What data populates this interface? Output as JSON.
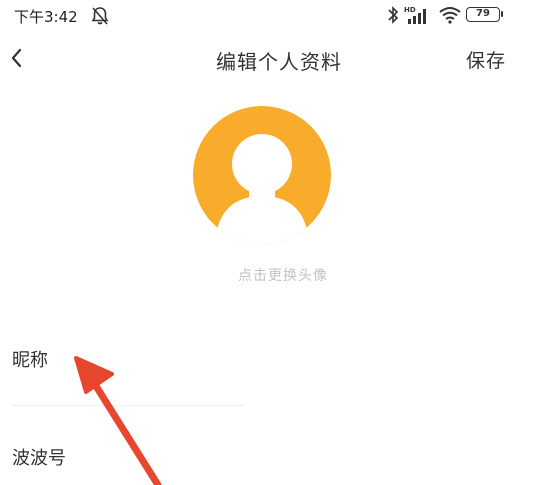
{
  "status_bar": {
    "time": "下午3:42",
    "network_label": "HD",
    "battery": "79"
  },
  "header": {
    "title": "编辑个人资料",
    "save_label": "保存"
  },
  "avatar": {
    "hint": "点击更换头像"
  },
  "form": {
    "nickname_label": "昵称",
    "boboid_label": "波波号"
  },
  "colors": {
    "avatar_bg": "#f9ac2c",
    "arrow": "#e8472f",
    "hint_text": "#c2c2c2"
  }
}
